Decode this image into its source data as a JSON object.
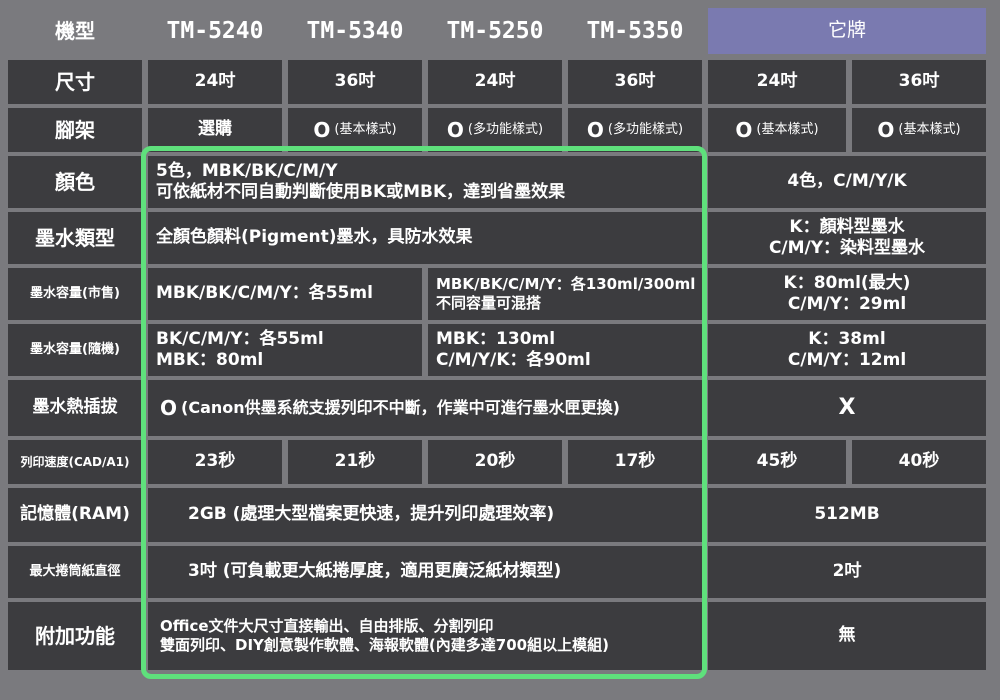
{
  "header": {
    "model_label": "機型",
    "models": [
      "TM-5240",
      "TM-5340",
      "TM-5250",
      "TM-5350"
    ],
    "other_brand": "它牌"
  },
  "rows": {
    "size": {
      "label": "尺寸",
      "values": [
        "24吋",
        "36吋",
        "24吋",
        "36吋",
        "24吋",
        "36吋"
      ]
    },
    "stand": {
      "label": "腳架",
      "v1": "選購",
      "mark": "O",
      "notes": [
        "(基本樣式)",
        "(多功能樣式)",
        "(多功能樣式)",
        "(基本樣式)",
        "(基本樣式)"
      ]
    },
    "color": {
      "label": "顏色",
      "epson": "5色，MBK/BK/C/M/Y\n可依紙材不同自動判斷使用BK或MBK，達到省墨效果",
      "other": "4色，C/M/Y/K"
    },
    "ink_type": {
      "label": "墨水類型",
      "epson": "全顏色顏料(Pigment)墨水，具防水效果",
      "other": "K：顏料型墨水\nC/M/Y：染料型墨水"
    },
    "ink_retail": {
      "label": "墨水容量(市售)",
      "a": "MBK/BK/C/M/Y：各55ml",
      "b": "MBK/BK/C/M/Y：各130ml/300ml\n不同容量可混搭",
      "other": "K：80ml(最大)\nC/M/Y：29ml"
    },
    "ink_bundled": {
      "label": "墨水容量(隨機)",
      "a": "BK/C/M/Y：各55ml\nMBK：80ml",
      "b": "MBK：130ml\nC/M/Y/K：各90ml",
      "other": "K：38ml\nC/M/Y：12ml"
    },
    "hot_swap": {
      "label": "墨水熱插拔",
      "mark": "O",
      "epson": "(Canon供墨系統支援列印不中斷，作業中可進行墨水匣更換)",
      "other": "X"
    },
    "speed": {
      "label": "列印速度(CAD/A1)",
      "values": [
        "23秒",
        "21秒",
        "20秒",
        "17秒",
        "45秒",
        "40秒"
      ]
    },
    "memory": {
      "label": "記憶體(RAM)",
      "epson": "2GB (處理大型檔案更快速，提升列印處理效率)",
      "other": "512MB"
    },
    "roll": {
      "label": "最大捲筒紙直徑",
      "epson": "3吋 (可負載更大紙捲厚度，適用更廣泛紙材類型)",
      "other": "2吋"
    },
    "extra": {
      "label": "附加功能",
      "epson": "Office文件大尺寸直接輸出、自由排版、分割列印\n雙面列印、DIY創意製作軟體、海報軟體(內建多達700組以上模組)",
      "other": "無"
    }
  },
  "colors": {
    "background": "#7a7a7e",
    "cell": "#3c3c3f",
    "highlight": "#5fe07c",
    "other_header": "#7a7ab0"
  }
}
